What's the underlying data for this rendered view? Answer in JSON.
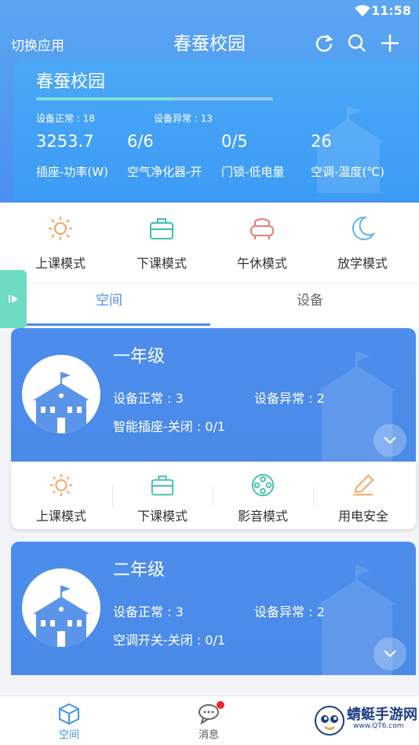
{
  "status": {
    "time": "11:58"
  },
  "topbar": {
    "switch_app": "切换应用",
    "title": "春蚕校园"
  },
  "hero": {
    "title": "春蚕校园",
    "progress_fraction": 0.58,
    "device_ok": "设备正常 : 18",
    "device_err": "设备异常 : 13",
    "values": [
      "3253.7",
      "6/6",
      "0/5",
      "26"
    ],
    "labels": [
      "插座-功率(W)",
      "空气净化器-开",
      "门锁-低电量",
      "空调-温度(℃)"
    ]
  },
  "modes": [
    {
      "label": "上课模式",
      "icon": "sun-icon"
    },
    {
      "label": "下课模式",
      "icon": "briefcase-icon"
    },
    {
      "label": "午休模式",
      "icon": "sofa-icon"
    },
    {
      "label": "放学模式",
      "icon": "moon-icon"
    }
  ],
  "tabs": {
    "space": "空间",
    "device": "设备",
    "active": "space"
  },
  "classes": [
    {
      "name": "一年级",
      "device_ok": "设备正常 : 3",
      "device_err": "设备异常 : 2",
      "extra": "智能插座-关闭 : 0/1",
      "actions": [
        "上课模式",
        "下课模式",
        "影音模式",
        "用电安全"
      ]
    },
    {
      "name": "二年级",
      "device_ok": "设备正常 : 3",
      "device_err": "设备异常 : 2",
      "extra": "空调开关-关闭 : 0/1"
    }
  ],
  "bottom_nav": {
    "space": "空间",
    "messages": "消息"
  },
  "watermark": {
    "text": "蜻蜓手游网",
    "sub": "www.QT6.com"
  },
  "colors": {
    "primary": "#4a8be8",
    "accent_orange": "#f5a35c",
    "accent_teal": "#3fbfae",
    "accent_red": "#f07a78",
    "accent_blue": "#5cb3f0"
  }
}
